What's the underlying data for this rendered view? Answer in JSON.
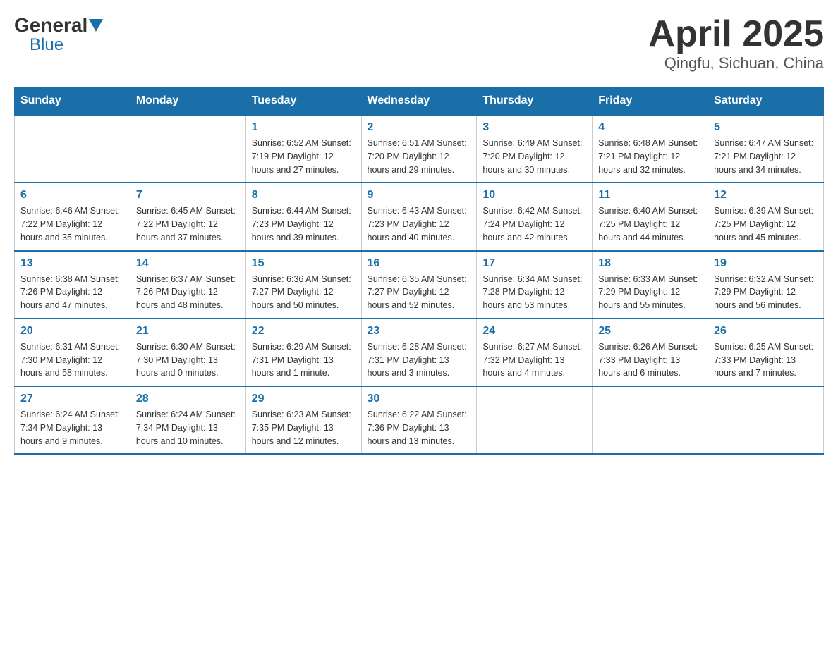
{
  "header": {
    "logo_general": "General",
    "logo_blue": "Blue",
    "title": "April 2025",
    "subtitle": "Qingfu, Sichuan, China"
  },
  "weekdays": [
    "Sunday",
    "Monday",
    "Tuesday",
    "Wednesday",
    "Thursday",
    "Friday",
    "Saturday"
  ],
  "weeks": [
    [
      {
        "day": "",
        "info": ""
      },
      {
        "day": "",
        "info": ""
      },
      {
        "day": "1",
        "info": "Sunrise: 6:52 AM\nSunset: 7:19 PM\nDaylight: 12 hours\nand 27 minutes."
      },
      {
        "day": "2",
        "info": "Sunrise: 6:51 AM\nSunset: 7:20 PM\nDaylight: 12 hours\nand 29 minutes."
      },
      {
        "day": "3",
        "info": "Sunrise: 6:49 AM\nSunset: 7:20 PM\nDaylight: 12 hours\nand 30 minutes."
      },
      {
        "day": "4",
        "info": "Sunrise: 6:48 AM\nSunset: 7:21 PM\nDaylight: 12 hours\nand 32 minutes."
      },
      {
        "day": "5",
        "info": "Sunrise: 6:47 AM\nSunset: 7:21 PM\nDaylight: 12 hours\nand 34 minutes."
      }
    ],
    [
      {
        "day": "6",
        "info": "Sunrise: 6:46 AM\nSunset: 7:22 PM\nDaylight: 12 hours\nand 35 minutes."
      },
      {
        "day": "7",
        "info": "Sunrise: 6:45 AM\nSunset: 7:22 PM\nDaylight: 12 hours\nand 37 minutes."
      },
      {
        "day": "8",
        "info": "Sunrise: 6:44 AM\nSunset: 7:23 PM\nDaylight: 12 hours\nand 39 minutes."
      },
      {
        "day": "9",
        "info": "Sunrise: 6:43 AM\nSunset: 7:23 PM\nDaylight: 12 hours\nand 40 minutes."
      },
      {
        "day": "10",
        "info": "Sunrise: 6:42 AM\nSunset: 7:24 PM\nDaylight: 12 hours\nand 42 minutes."
      },
      {
        "day": "11",
        "info": "Sunrise: 6:40 AM\nSunset: 7:25 PM\nDaylight: 12 hours\nand 44 minutes."
      },
      {
        "day": "12",
        "info": "Sunrise: 6:39 AM\nSunset: 7:25 PM\nDaylight: 12 hours\nand 45 minutes."
      }
    ],
    [
      {
        "day": "13",
        "info": "Sunrise: 6:38 AM\nSunset: 7:26 PM\nDaylight: 12 hours\nand 47 minutes."
      },
      {
        "day": "14",
        "info": "Sunrise: 6:37 AM\nSunset: 7:26 PM\nDaylight: 12 hours\nand 48 minutes."
      },
      {
        "day": "15",
        "info": "Sunrise: 6:36 AM\nSunset: 7:27 PM\nDaylight: 12 hours\nand 50 minutes."
      },
      {
        "day": "16",
        "info": "Sunrise: 6:35 AM\nSunset: 7:27 PM\nDaylight: 12 hours\nand 52 minutes."
      },
      {
        "day": "17",
        "info": "Sunrise: 6:34 AM\nSunset: 7:28 PM\nDaylight: 12 hours\nand 53 minutes."
      },
      {
        "day": "18",
        "info": "Sunrise: 6:33 AM\nSunset: 7:29 PM\nDaylight: 12 hours\nand 55 minutes."
      },
      {
        "day": "19",
        "info": "Sunrise: 6:32 AM\nSunset: 7:29 PM\nDaylight: 12 hours\nand 56 minutes."
      }
    ],
    [
      {
        "day": "20",
        "info": "Sunrise: 6:31 AM\nSunset: 7:30 PM\nDaylight: 12 hours\nand 58 minutes."
      },
      {
        "day": "21",
        "info": "Sunrise: 6:30 AM\nSunset: 7:30 PM\nDaylight: 13 hours\nand 0 minutes."
      },
      {
        "day": "22",
        "info": "Sunrise: 6:29 AM\nSunset: 7:31 PM\nDaylight: 13 hours\nand 1 minute."
      },
      {
        "day": "23",
        "info": "Sunrise: 6:28 AM\nSunset: 7:31 PM\nDaylight: 13 hours\nand 3 minutes."
      },
      {
        "day": "24",
        "info": "Sunrise: 6:27 AM\nSunset: 7:32 PM\nDaylight: 13 hours\nand 4 minutes."
      },
      {
        "day": "25",
        "info": "Sunrise: 6:26 AM\nSunset: 7:33 PM\nDaylight: 13 hours\nand 6 minutes."
      },
      {
        "day": "26",
        "info": "Sunrise: 6:25 AM\nSunset: 7:33 PM\nDaylight: 13 hours\nand 7 minutes."
      }
    ],
    [
      {
        "day": "27",
        "info": "Sunrise: 6:24 AM\nSunset: 7:34 PM\nDaylight: 13 hours\nand 9 minutes."
      },
      {
        "day": "28",
        "info": "Sunrise: 6:24 AM\nSunset: 7:34 PM\nDaylight: 13 hours\nand 10 minutes."
      },
      {
        "day": "29",
        "info": "Sunrise: 6:23 AM\nSunset: 7:35 PM\nDaylight: 13 hours\nand 12 minutes."
      },
      {
        "day": "30",
        "info": "Sunrise: 6:22 AM\nSunset: 7:36 PM\nDaylight: 13 hours\nand 13 minutes."
      },
      {
        "day": "",
        "info": ""
      },
      {
        "day": "",
        "info": ""
      },
      {
        "day": "",
        "info": ""
      }
    ]
  ]
}
